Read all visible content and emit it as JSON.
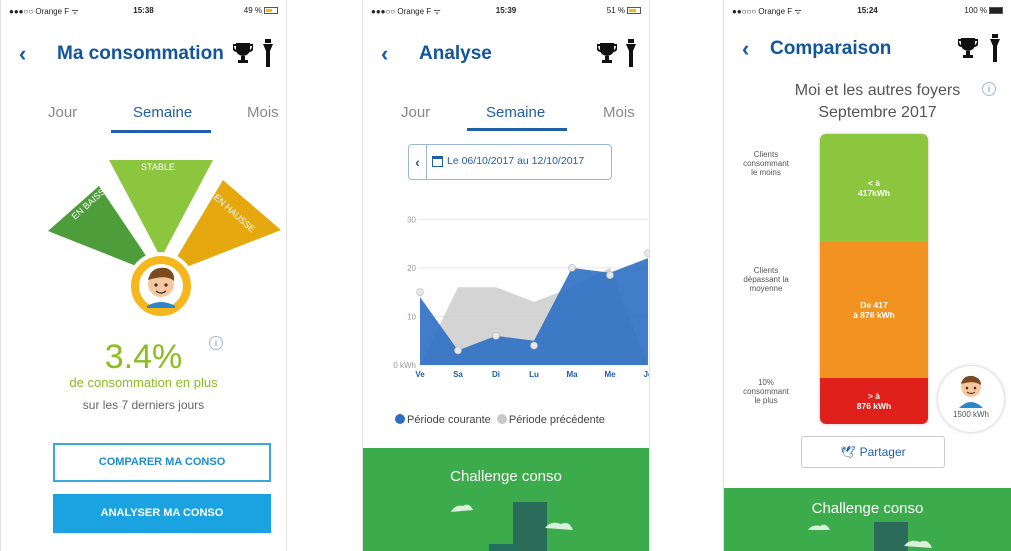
{
  "screens": {
    "consommation": {
      "status": {
        "carrier": "●●●○○ Orange F ᯤ",
        "time": "15:38",
        "battery": "49 %"
      },
      "title": "Ma consommation",
      "tabs": [
        "Jour",
        "Semaine",
        "Mois"
      ],
      "gauge": {
        "left": "EN BAISSE",
        "center": "STABLE",
        "right": "EN HAUSSE"
      },
      "percent": "3.4%",
      "info": "i",
      "line1": "de consommation en plus",
      "line2": "sur les 7 derniers jours",
      "compare_button": "COMPARER MA CONSO",
      "analyse_button": "ANALYSER MA CONSO"
    },
    "analyse": {
      "status": {
        "carrier": "●●●○○ Orange F ᯤ",
        "time": "15:39",
        "battery": "51 %"
      },
      "title": "Analyse",
      "tabs": [
        "Jour",
        "Semaine",
        "Mois"
      ],
      "date_range": "Le 06/10/2017 au 12/10/2017",
      "legend_current": "Période courante",
      "legend_previous": "Période précédente",
      "footer_title": "Challenge conso"
    },
    "comparaison": {
      "status": {
        "carrier": "●●○○○ Orange F ᯤ",
        "time": "15:24",
        "battery": "100 %"
      },
      "title": "Comparaison",
      "heading_line1": "Moi et les autres foyers",
      "heading_line2": "Septembre 2017",
      "info": "i",
      "segments": [
        {
          "label": [
            "Clients",
            "consommant",
            "le moins"
          ],
          "value": [
            "< à",
            "417kWh"
          ],
          "color": "#8cc63f"
        },
        {
          "label": [
            "Clients",
            "dépassant la",
            "moyenne"
          ],
          "value": [
            "De 417",
            "à 876 kWh"
          ],
          "color": "#f29221"
        },
        {
          "label": [
            "10%",
            "consommant",
            "le plus"
          ],
          "value": [
            "> à",
            "876 kWh"
          ],
          "color": "#e0201b"
        }
      ],
      "my_consumption": "1500 kWh",
      "share_button": "Partager",
      "footer_title": "Challenge conso"
    }
  },
  "chart_data": {
    "type": "area",
    "categories": [
      "Ve",
      "Sa",
      "Di",
      "Lu",
      "Ma",
      "Me",
      "Je"
    ],
    "y_ticks": [
      "0 kWh",
      "10",
      "20",
      "30"
    ],
    "ylim": [
      0,
      35
    ],
    "series": [
      {
        "name": "Période courante",
        "color": "#2e6fc4",
        "values": [
          14,
          3,
          6,
          5,
          20,
          19,
          22
        ]
      },
      {
        "name": "Période précédente",
        "color": "#cccccc",
        "values": [
          0,
          16,
          16,
          13,
          16,
          20,
          0
        ]
      }
    ],
    "markers": [
      [
        15,
        3,
        6,
        4,
        20,
        18.5,
        23
      ]
    ],
    "grid": true,
    "legend_position": "bottom"
  }
}
